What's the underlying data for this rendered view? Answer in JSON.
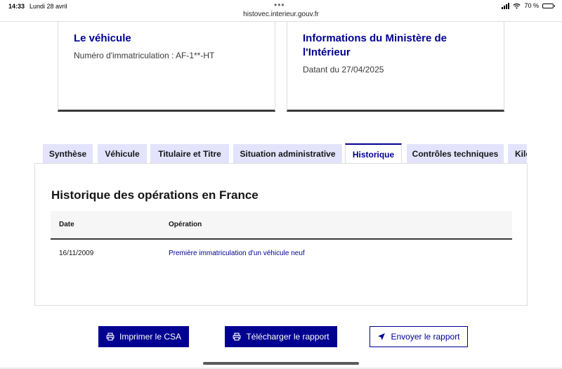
{
  "status_bar": {
    "time": "14:33",
    "date": "Lundi 28 avril",
    "url": "histovec.interieur.gouv.fr",
    "battery": "70 %",
    "battery_level": 0.7
  },
  "cards": {
    "vehicle": {
      "title": "Le véhicule",
      "plate_label": "Numéro d'immatriculation : AF-1**-HT"
    },
    "ministry": {
      "title": "Informations du Ministère de l'Intérieur",
      "date_label": "Datant du 27/04/2025"
    }
  },
  "tabs": [
    {
      "label": "Synthèse",
      "active": false
    },
    {
      "label": "Véhicule",
      "active": false
    },
    {
      "label": "Titulaire et Titre",
      "active": false
    },
    {
      "label": "Situation administrative",
      "active": false
    },
    {
      "label": "Historique",
      "active": true
    },
    {
      "label": "Contrôles techniques",
      "active": false
    },
    {
      "label": "Kilométrage",
      "active": false
    }
  ],
  "history": {
    "title": "Historique des opérations en France",
    "columns": [
      "Date",
      "Opération"
    ],
    "rows": [
      {
        "date": "16/11/2009",
        "operation": "Première immatriculation d'un véhicule neuf"
      }
    ]
  },
  "actions": {
    "print_label": "Imprimer le CSA",
    "download_label": "Télécharger le rapport",
    "send_label": "Envoyer le rapport"
  },
  "colors": {
    "primary": "#000091",
    "tab_bg": "#e3e3fd",
    "text": "#161616"
  }
}
